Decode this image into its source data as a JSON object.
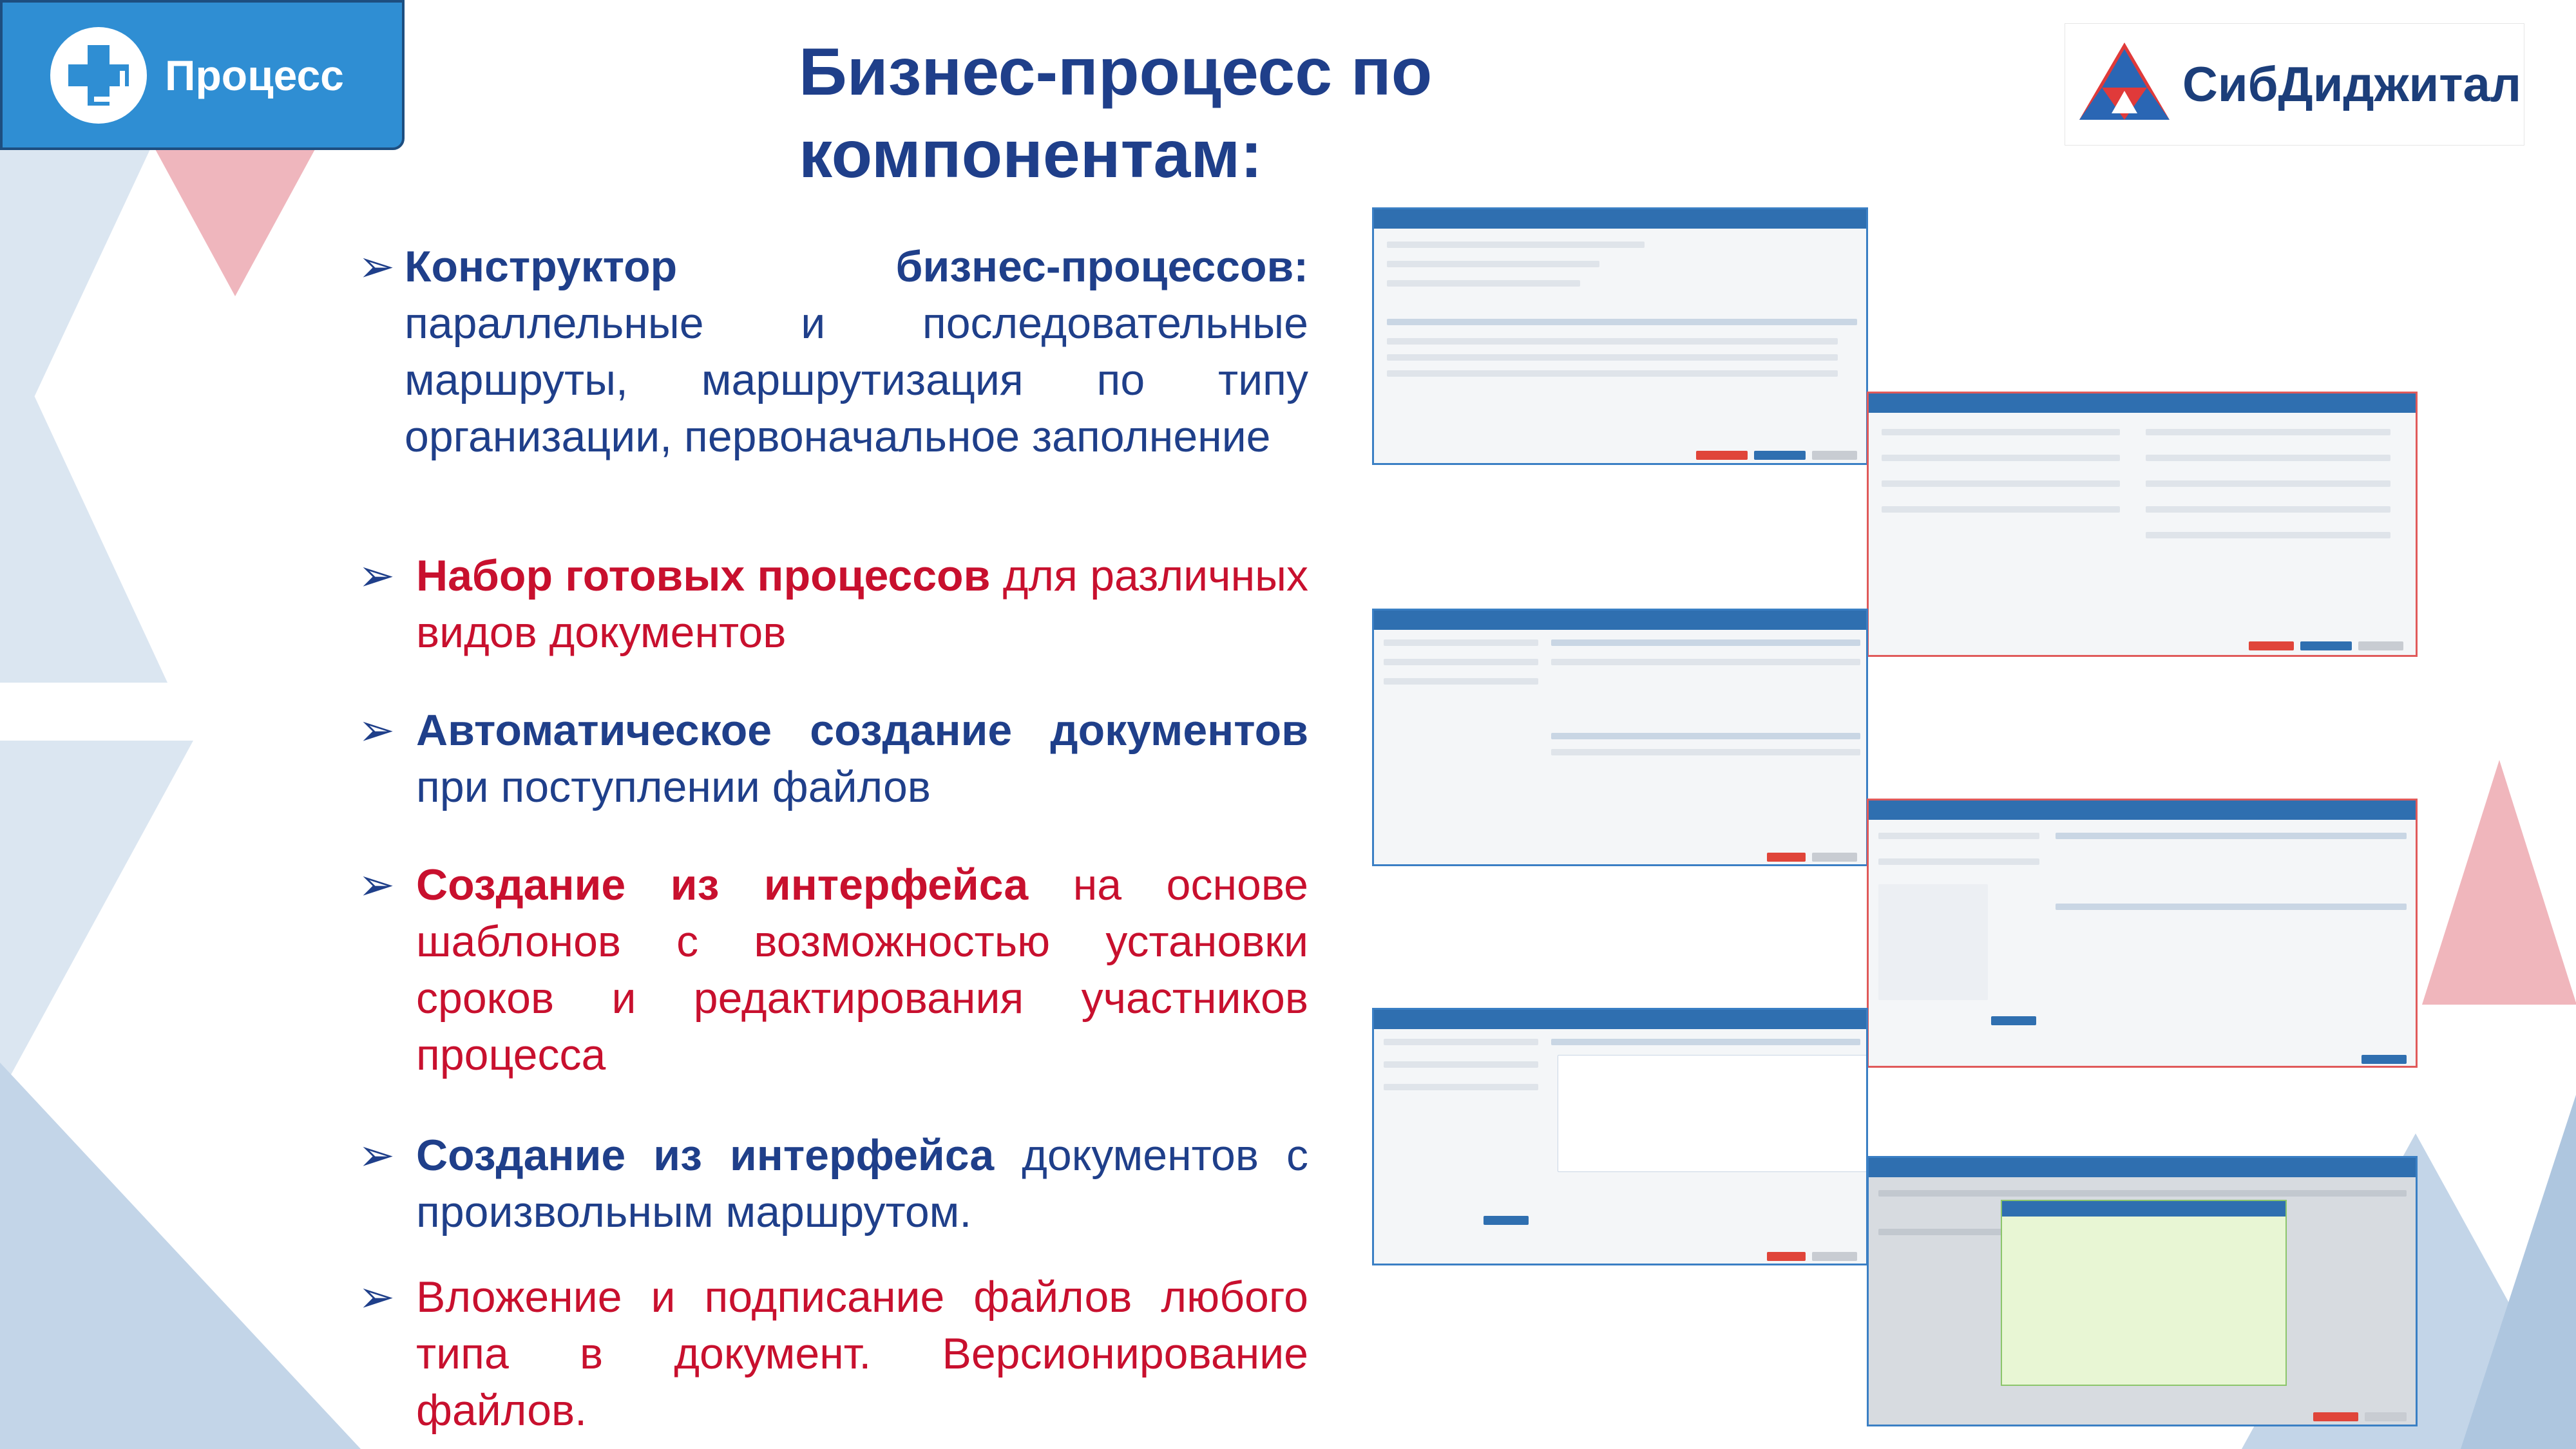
{
  "header": {
    "badge_label": "Процесс",
    "title": "Бизнес-процесс по компонентам:",
    "brand_name": "СибДиджитал"
  },
  "bullets": [
    {
      "bold": "Конструктор бизнес-процессов:",
      "rest": " параллельные и последовательные маршруты, маршрутизация по типу организации, первоначальное заполнение",
      "bold_color": "blue",
      "rest_color": "blue"
    },
    {
      "bold": "Набор готовых процессов",
      "rest": " для различных видов документов",
      "bold_color": "red",
      "rest_color": "red"
    },
    {
      "bold": "Автоматическое создание документов",
      "rest": " при поступлении файлов",
      "bold_color": "blue",
      "rest_color": "blue"
    },
    {
      "bold": "Создание из интерфейса",
      "rest": " на основе шаблонов с возможностью установки сроков и редактирования участников процесса",
      "bold_color": "red",
      "rest_color": "red"
    },
    {
      "bold": "Создание из интерфейса",
      "rest": " документов с произвольным маршрутом.",
      "bold_color": "blue",
      "rest_color": "blue"
    },
    {
      "bold": "",
      "rest": "Вложение и подписание файлов любого типа в документ. Версионирование файлов.",
      "bold_color": "red",
      "rest_color": "red"
    }
  ],
  "bullet_marker": "➢",
  "colors": {
    "brand_blue": "#1f3f8a",
    "accent_red": "#c8102e",
    "badge_blue": "#2f8ed3"
  },
  "icons": [
    "process-logo-icon",
    "sibdigital-logo-icon",
    "arrow-bullet-icon"
  ]
}
